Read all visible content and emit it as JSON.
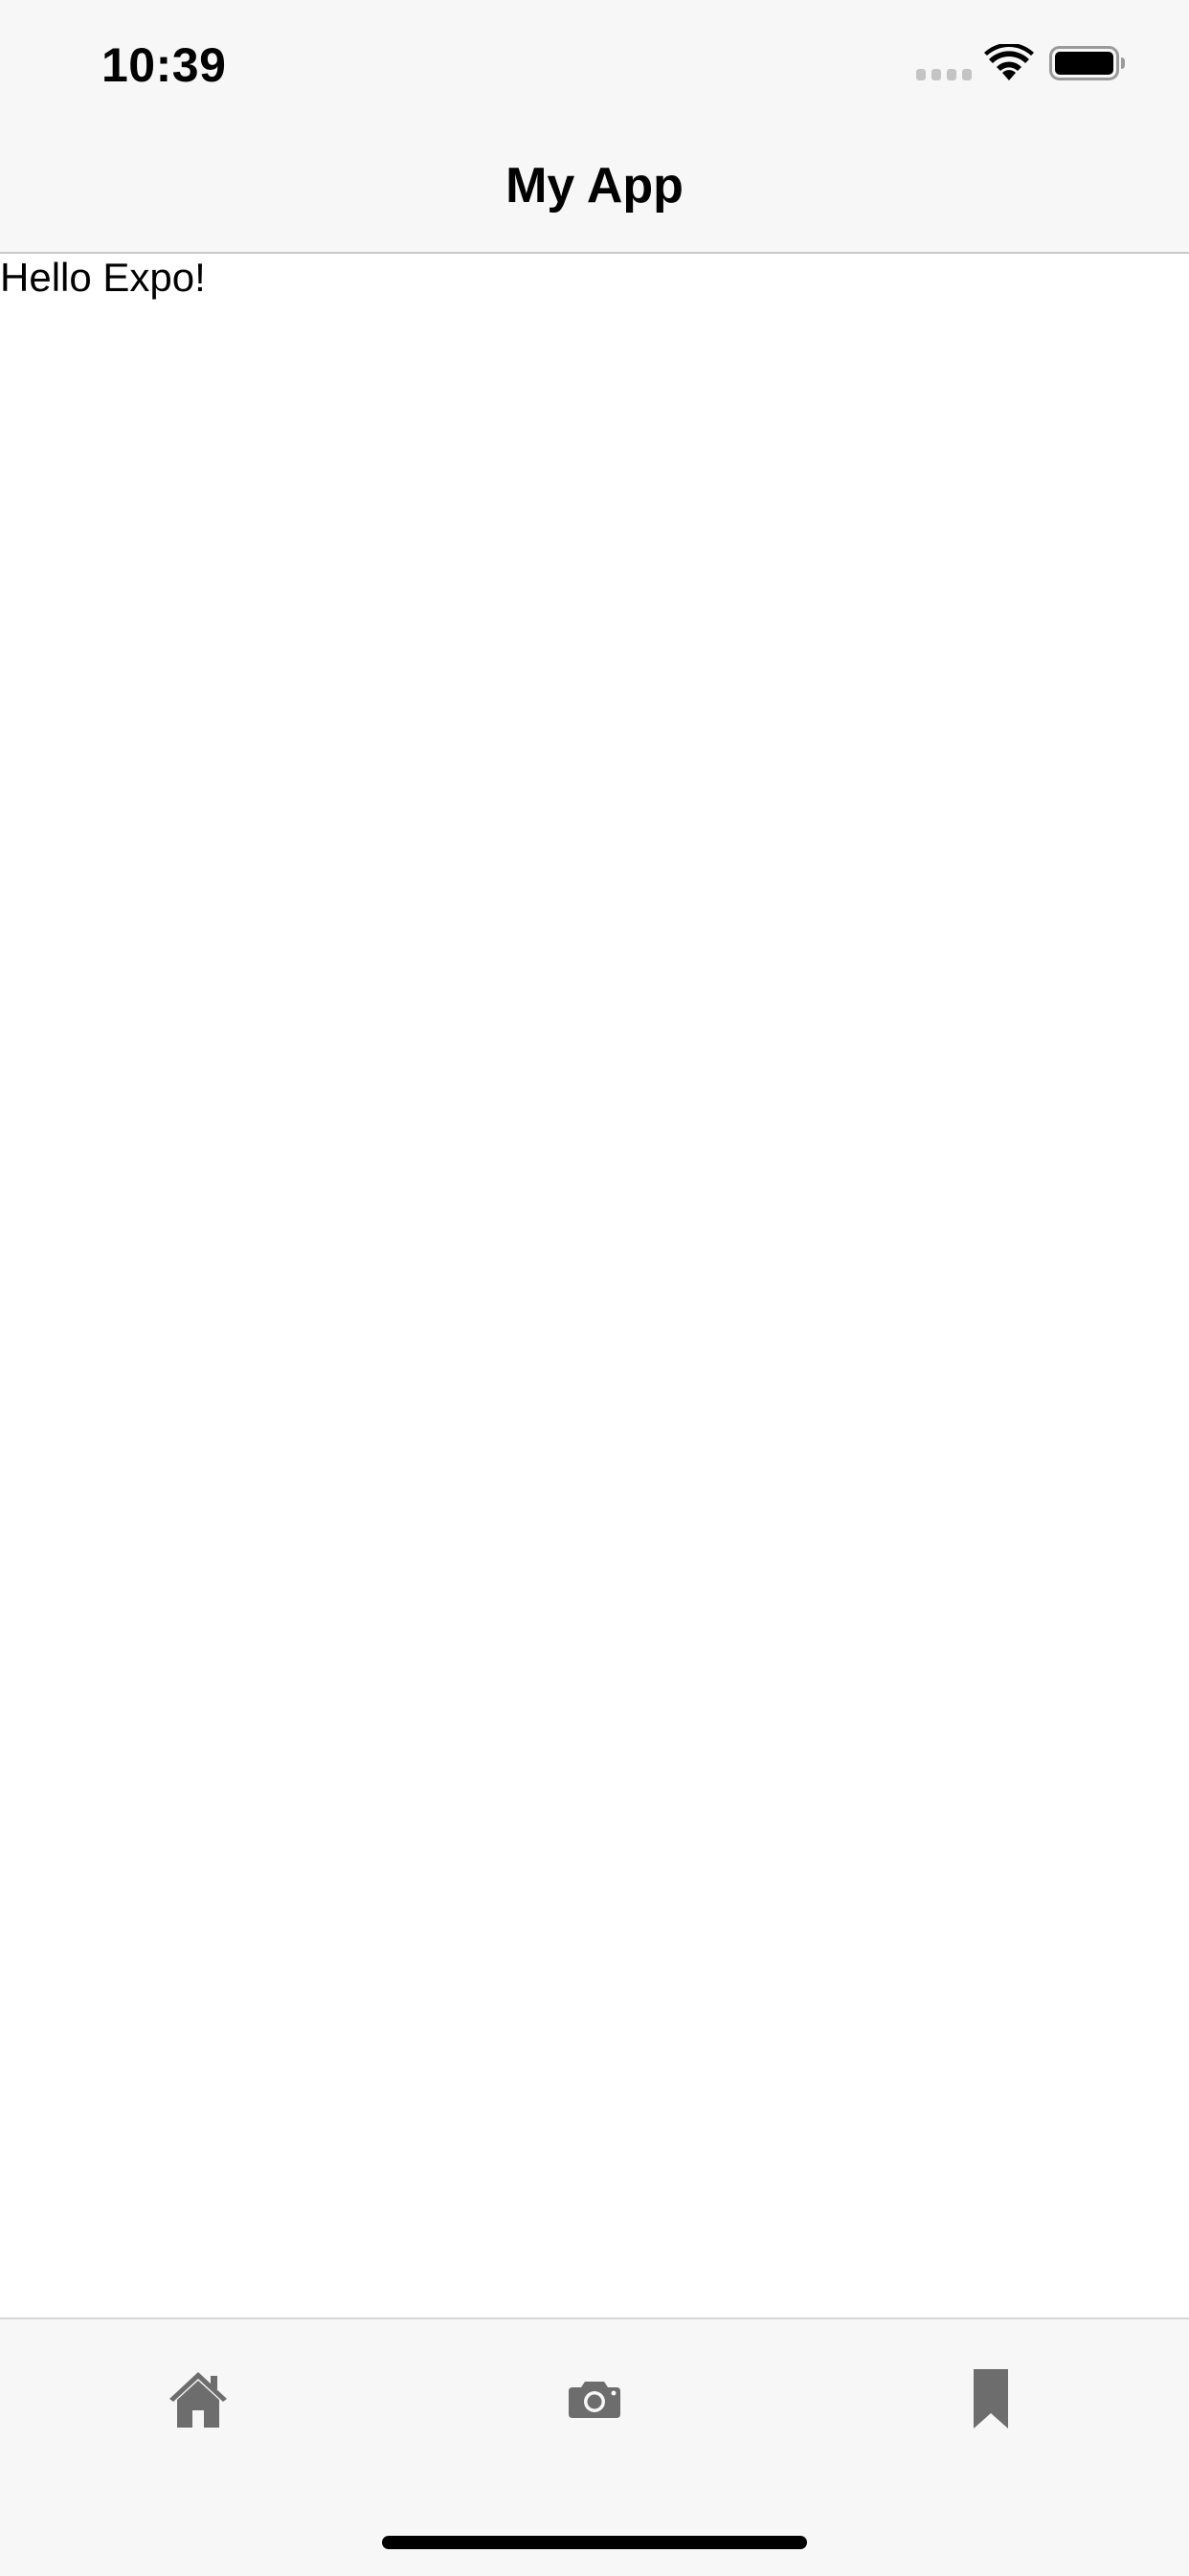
{
  "status_bar": {
    "time": "10:39",
    "signal_icon": "cellular-signal-icon",
    "wifi_icon": "wifi-icon",
    "battery_icon": "battery-icon"
  },
  "header": {
    "title": "My App"
  },
  "main": {
    "text": "Hello Expo!"
  },
  "tab_bar": {
    "items": [
      {
        "icon": "home-icon"
      },
      {
        "icon": "camera-icon"
      },
      {
        "icon": "bookmark-icon"
      }
    ],
    "icon_color": "#6d6d6d"
  },
  "colors": {
    "bar_background": "#f7f7f7",
    "content_background": "#ffffff",
    "separator": "#c9c9c9"
  }
}
